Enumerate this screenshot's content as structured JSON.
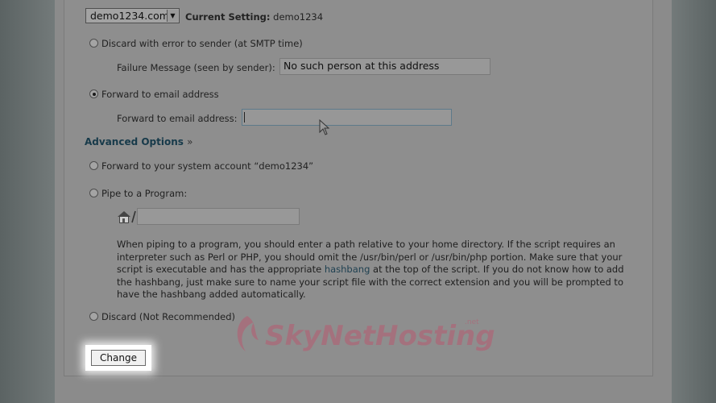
{
  "domain_select": {
    "value": "demo1234.com"
  },
  "current_setting": {
    "label": "Current Setting:",
    "value": "demo1234"
  },
  "options": {
    "discard_error": {
      "label": "Discard with error to sender (at SMTP time)"
    },
    "failure_message": {
      "label": "Failure Message (seen by sender):",
      "value": "No such person at this address"
    },
    "forward_email": {
      "label": "Forward to email address"
    },
    "forward_email_field": {
      "label": "Forward to email address:",
      "value": ""
    },
    "advanced": {
      "label": "Advanced Options",
      "suffix": "»"
    },
    "forward_system": {
      "label": "Forward to your system account “demo1234”"
    },
    "pipe": {
      "label": "Pipe to a Program:",
      "path_value": ""
    },
    "pipe_help": {
      "part1": "When piping to a program, you should enter a path relative to your home directory. If the script requires an interpreter such as Perl or PHP, you should omit the /usr/bin/perl or /usr/bin/php portion. Make sure that your script is executable and has the appropriate ",
      "link": "hashbang",
      "part2": " at the top of the script. If you do not know how to add the hashbang, just make sure to name your script file with the correct extension and you will be prompted to have the hashbang added automatically."
    },
    "discard": {
      "label": "Discard (Not Recommended)"
    }
  },
  "change_button": {
    "label": "Change"
  },
  "watermark": {
    "text": "SkyNetHosting",
    "suffix": ".net"
  },
  "colors": {
    "panel": "#8e8e8e",
    "link": "#1d3f50",
    "watermark": "#c0506a"
  }
}
